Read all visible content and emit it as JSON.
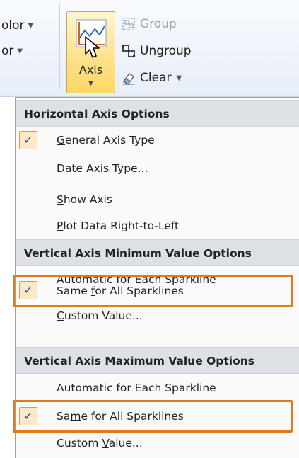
{
  "ribbon": {
    "left_fragments": [
      "olor",
      "or"
    ],
    "axis_button": {
      "label": "Axis",
      "icon": "axis-chart-icon"
    },
    "group_label": "Group",
    "ungroup_label": "Ungroup",
    "clear_label": "Clear"
  },
  "menu": {
    "sections": [
      {
        "header": "Horizontal Axis Options",
        "items": [
          {
            "pre": "",
            "key": "G",
            "post": "eneral Axis Type",
            "checked": true
          },
          {
            "pre": "",
            "key": "D",
            "post": "ate Axis Type...",
            "checked": false
          },
          {
            "pre": "",
            "key": "S",
            "post": "how Axis",
            "checked": false
          },
          {
            "pre": "",
            "key": "P",
            "post": "lot Data Right-to-Left",
            "checked": false
          }
        ]
      },
      {
        "header": "Vertical Axis Minimum Value Options",
        "items": [
          {
            "pre": "",
            "key": "",
            "post": "Automatic for Each Sparkline",
            "checked": false
          },
          {
            "pre": "Same ",
            "key": "f",
            "post": "or All Sparklines",
            "checked": true,
            "highlighted": true
          },
          {
            "pre": "",
            "key": "C",
            "post": "ustom Value...",
            "checked": false
          }
        ]
      },
      {
        "header": "Vertical Axis Maximum Value Options",
        "items": [
          {
            "pre": "",
            "key": "",
            "post": "Automatic for Each Sparkline",
            "checked": false
          },
          {
            "pre": "Sa",
            "key": "m",
            "post": "e for All Sparklines",
            "checked": true,
            "highlighted": true
          },
          {
            "pre": "Custom ",
            "key": "V",
            "post": "alue...",
            "checked": false
          }
        ]
      }
    ]
  },
  "colors": {
    "highlight_border": "#e07a1d",
    "check_bg": "#fde8c8",
    "check_border": "#f29436",
    "header_bg": "#dde1e6",
    "button_active": "#ffe28f"
  }
}
